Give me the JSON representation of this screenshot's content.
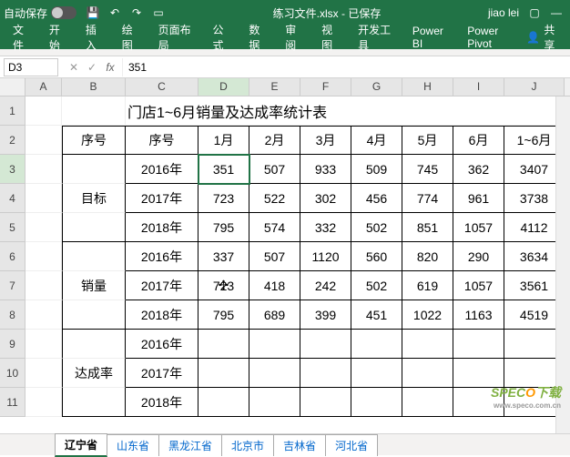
{
  "titlebar": {
    "autosave": "自动保存",
    "filename": "练习文件.xlsx - 已保存",
    "user": "jiao lei"
  },
  "ribbon": {
    "tabs": [
      "文件",
      "开始",
      "插入",
      "绘图",
      "页面布局",
      "公式",
      "数据",
      "审阅",
      "视图",
      "开发工具",
      "Power BI",
      "Power Pivot"
    ],
    "share": "共享"
  },
  "formula": {
    "namebox": "D3",
    "value": "351"
  },
  "columns": [
    "A",
    "B",
    "C",
    "D",
    "E",
    "F",
    "G",
    "H",
    "I",
    "J"
  ],
  "rownums": [
    "1",
    "2",
    "3",
    "4",
    "5",
    "6",
    "7",
    "8",
    "9",
    "10",
    "11"
  ],
  "table": {
    "title": "门店1~6月销量及达成率统计表",
    "h_seq": "序号",
    "h_seq2": "序号",
    "months": [
      "1月",
      "2月",
      "3月",
      "4月",
      "5月",
      "6月",
      "1~6月"
    ],
    "groups": [
      {
        "name": "目标",
        "rows": [
          {
            "year": "2016年",
            "vals": [
              "351",
              "507",
              "933",
              "509",
              "745",
              "362",
              "3407"
            ]
          },
          {
            "year": "2017年",
            "vals": [
              "723",
              "522",
              "302",
              "456",
              "774",
              "961",
              "3738"
            ]
          },
          {
            "year": "2018年",
            "vals": [
              "795",
              "574",
              "332",
              "502",
              "851",
              "1057",
              "4112"
            ]
          }
        ]
      },
      {
        "name": "销量",
        "rows": [
          {
            "year": "2016年",
            "vals": [
              "337",
              "507",
              "1120",
              "560",
              "820",
              "290",
              "3634"
            ]
          },
          {
            "year": "2017年",
            "vals": [
              "723",
              "418",
              "242",
              "502",
              "619",
              "1057",
              "3561"
            ]
          },
          {
            "year": "2018年",
            "vals": [
              "795",
              "689",
              "399",
              "451",
              "1022",
              "1163",
              "4519"
            ]
          }
        ]
      },
      {
        "name": "达成率",
        "rows": [
          {
            "year": "2016年",
            "vals": [
              "",
              "",
              "",
              "",
              "",
              "",
              ""
            ]
          },
          {
            "year": "2017年",
            "vals": [
              "",
              "",
              "",
              "",
              "",
              "",
              ""
            ]
          },
          {
            "year": "2018年",
            "vals": [
              "",
              "",
              "",
              "",
              "",
              "",
              ""
            ]
          }
        ]
      }
    ]
  },
  "sheets": [
    "辽宁省",
    "山东省",
    "黑龙江省",
    "北京市",
    "吉林省",
    "河北省"
  ],
  "watermark": "SPECO下载"
}
